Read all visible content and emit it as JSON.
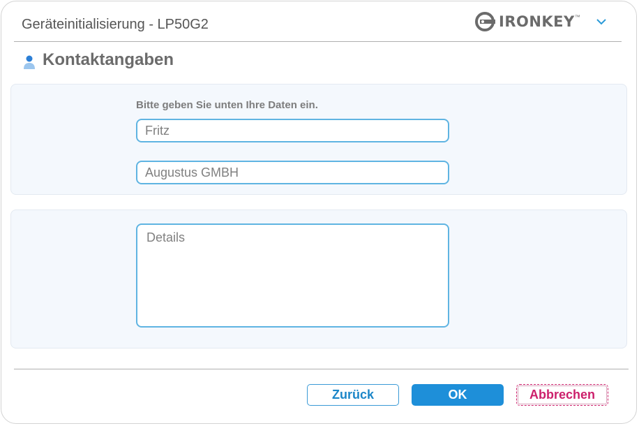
{
  "window": {
    "title": "Geräteinitialisierung - LP50G2"
  },
  "brand": {
    "logo_text": "IRONKEY",
    "trademark": "™"
  },
  "section": {
    "title": "Kontaktangaben"
  },
  "form": {
    "instruction": "Bitte geben Sie unten Ihre Daten ein.",
    "name_value": "Fritz",
    "company_value": "Augustus GMBH",
    "details_placeholder": "Details"
  },
  "buttons": {
    "back": "Zurück",
    "ok": "OK",
    "cancel": "Abbrechen"
  },
  "colors": {
    "accent": "#1e8fd9",
    "field_border": "#5fb4e2",
    "cancel": "#cc1f6b",
    "panel_bg": "#f4f8fd"
  },
  "icons": {
    "section": "user-icon",
    "brand": "key-logo-icon",
    "menu": "chevron-down-icon"
  }
}
